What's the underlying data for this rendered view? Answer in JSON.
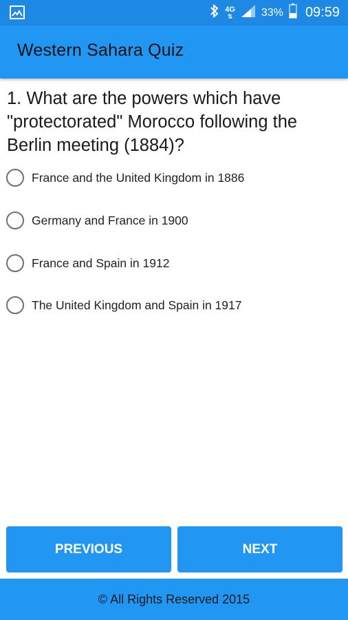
{
  "status_bar": {
    "network": "4G",
    "battery_percent": "33%",
    "time": "09:59",
    "icons": [
      "gallery-icon",
      "bluetooth-icon",
      "network-arrows-icon",
      "signal-icon",
      "battery-icon"
    ]
  },
  "app_bar": {
    "title": "Western Sahara Quiz"
  },
  "question": {
    "text": "1. What are the powers which have \"protectorated\" Morocco following the Berlin meeting (1884)?"
  },
  "options": [
    {
      "label": "France and the United Kingdom in 1886"
    },
    {
      "label": "Germany and France in 1900"
    },
    {
      "label": "France and Spain in 1912"
    },
    {
      "label": "The United Kingdom and Spain in 1917"
    }
  ],
  "buttons": {
    "previous": "PREVIOUS",
    "next": "NEXT"
  },
  "footer": {
    "text": "© All Rights Reserved 2015"
  },
  "colors": {
    "status_bar": "#1e88e5",
    "primary": "#2196f3",
    "radio_border": "#6f6f6f"
  }
}
